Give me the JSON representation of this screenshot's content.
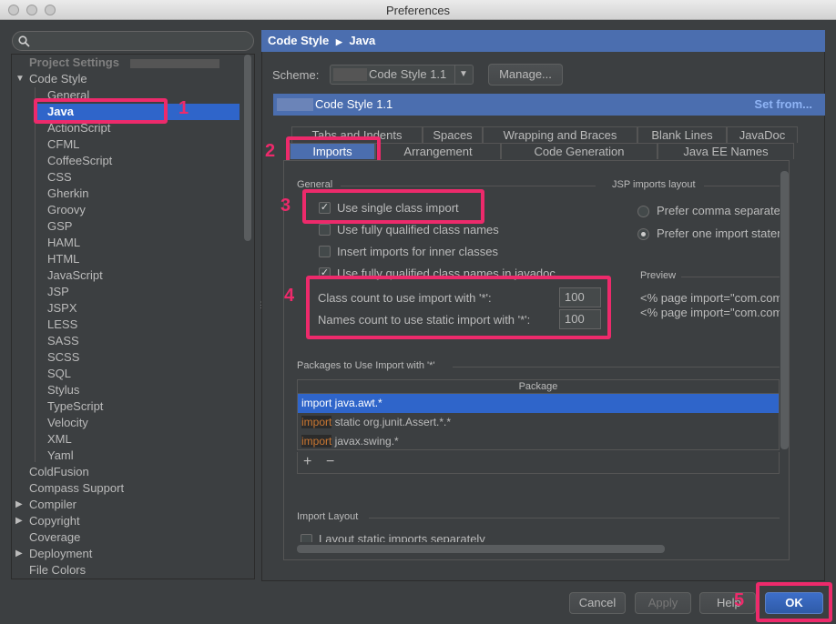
{
  "window": {
    "title": "Preferences"
  },
  "search": {
    "placeholder": ""
  },
  "sidebar": {
    "section": "Project Settings",
    "code_style": "Code Style",
    "languages": [
      "General",
      "Java",
      "ActionScript",
      "CFML",
      "CoffeeScript",
      "CSS",
      "Gherkin",
      "Groovy",
      "GSP",
      "HAML",
      "HTML",
      "JavaScript",
      "JSP",
      "JSPX",
      "LESS",
      "SASS",
      "SCSS",
      "SQL",
      "Stylus",
      "TypeScript",
      "Velocity",
      "XML",
      "Yaml"
    ],
    "others": [
      "ColdFusion",
      "Compass Support",
      "Compiler",
      "Copyright",
      "Coverage",
      "Deployment",
      "File Colors"
    ],
    "expandable": [
      "Compiler",
      "Copyright",
      "Deployment"
    ]
  },
  "breadcrumb": {
    "part1": "Code Style",
    "part2": "Java"
  },
  "scheme": {
    "label": "Scheme:",
    "value": "Code Style 1.1",
    "manage": "Manage...",
    "header": "Code Style 1.1",
    "set_from": "Set from..."
  },
  "tabs": {
    "row1": [
      "Tabs and Indents",
      "Spaces",
      "Wrapping and Braces",
      "Blank Lines",
      "JavaDoc"
    ],
    "row2": [
      "Imports",
      "Arrangement",
      "Code Generation",
      "Java EE Names"
    ]
  },
  "general": {
    "title": "General",
    "options": [
      {
        "label": "Use single class import",
        "checked": true
      },
      {
        "label": "Use fully qualified class names",
        "checked": false
      },
      {
        "label": "Insert imports for inner classes",
        "checked": false
      },
      {
        "label": "Use fully qualified class names in javadoc",
        "checked": true
      }
    ],
    "class_count_label": "Class count to use import with '*':",
    "class_count": "100",
    "names_count_label": "Names count to use static import with '*':",
    "names_count": "100"
  },
  "jsp": {
    "title": "JSP imports layout",
    "option1": "Prefer comma separated import list",
    "option2": "Prefer one import statement per page directive",
    "selected": 2,
    "preview_title": "Preview",
    "preview_line1": "<% page import=\"com.company.Bar\"%>",
    "preview_line2": "<% page import=\"com.company.Foo\"%>"
  },
  "packages": {
    "title": "Packages to Use Import with '*'",
    "column": "Package",
    "rows": [
      {
        "prefix": "import",
        "text": " java.awt.*",
        "selected": true
      },
      {
        "prefix": "import",
        "text": " static org.junit.Assert.*.*",
        "selected": false
      },
      {
        "prefix": "import",
        "text": " javax.swing.*",
        "selected": false
      }
    ],
    "add": "+",
    "remove": "−"
  },
  "import_layout": {
    "title": "Import Layout",
    "option": "Layout static imports separately"
  },
  "footer": {
    "cancel": "Cancel",
    "apply": "Apply",
    "help": "Help",
    "ok": "OK"
  },
  "badges": [
    "1",
    "2",
    "3",
    "4",
    "5"
  ],
  "colors": {
    "accent": "#4b6eaf",
    "selection": "#2f65ca",
    "highlight": "#ed2a6b",
    "background": "#3c3f41",
    "keyword": "#cc7832"
  }
}
